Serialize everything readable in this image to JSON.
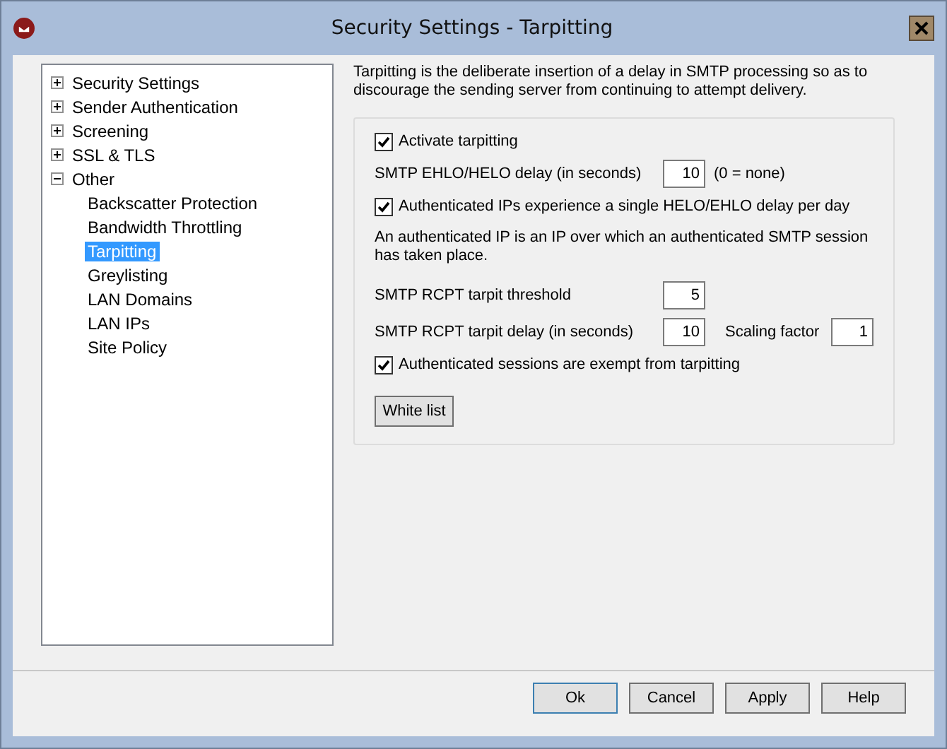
{
  "window": {
    "title": "Security Settings - Tarpitting"
  },
  "tree": [
    {
      "label": "Security Settings",
      "expanded": false,
      "selected": false
    },
    {
      "label": "Sender Authentication",
      "expanded": false,
      "selected": false
    },
    {
      "label": "Screening",
      "expanded": false,
      "selected": false
    },
    {
      "label": "SSL & TLS",
      "expanded": false,
      "selected": false
    },
    {
      "label": "Other",
      "expanded": true,
      "selected": false,
      "children": [
        {
          "label": "Backscatter Protection",
          "selected": false
        },
        {
          "label": "Bandwidth Throttling",
          "selected": false
        },
        {
          "label": "Tarpitting",
          "selected": true
        },
        {
          "label": "Greylisting",
          "selected": false
        },
        {
          "label": "LAN Domains",
          "selected": false
        },
        {
          "label": "LAN IPs",
          "selected": false
        },
        {
          "label": "Site Policy",
          "selected": false
        }
      ]
    }
  ],
  "description": "Tarpitting is the deliberate insertion of a delay in SMTP processing so as to discourage the sending server from continuing to attempt delivery.",
  "group": {
    "label": "Activate tarpitting",
    "checked": true
  },
  "ehlo_delay": {
    "label": "SMTP EHLO/HELO delay (in seconds)",
    "value": "10",
    "hint": "(0 = none)"
  },
  "single_delay": {
    "label": "Authenticated IPs experience a single HELO/EHLO delay per day",
    "checked": true
  },
  "note": "An authenticated IP is an IP over which an authenticated SMTP session has taken place.",
  "threshold": {
    "label": "SMTP RCPT tarpit threshold",
    "value": "5"
  },
  "rcpt_delay": {
    "label": "SMTP RCPT tarpit delay (in seconds)",
    "value": "10"
  },
  "scaling": {
    "label": "Scaling factor",
    "value": "1"
  },
  "exempt": {
    "label": "Authenticated sessions are exempt from tarpitting",
    "checked": true
  },
  "white_list_button": "White list",
  "buttons": [
    {
      "label": "Ok",
      "selected": true
    },
    {
      "label": "Cancel",
      "selected": false
    },
    {
      "label": "Apply",
      "selected": false
    },
    {
      "label": "Help",
      "selected": false
    }
  ]
}
